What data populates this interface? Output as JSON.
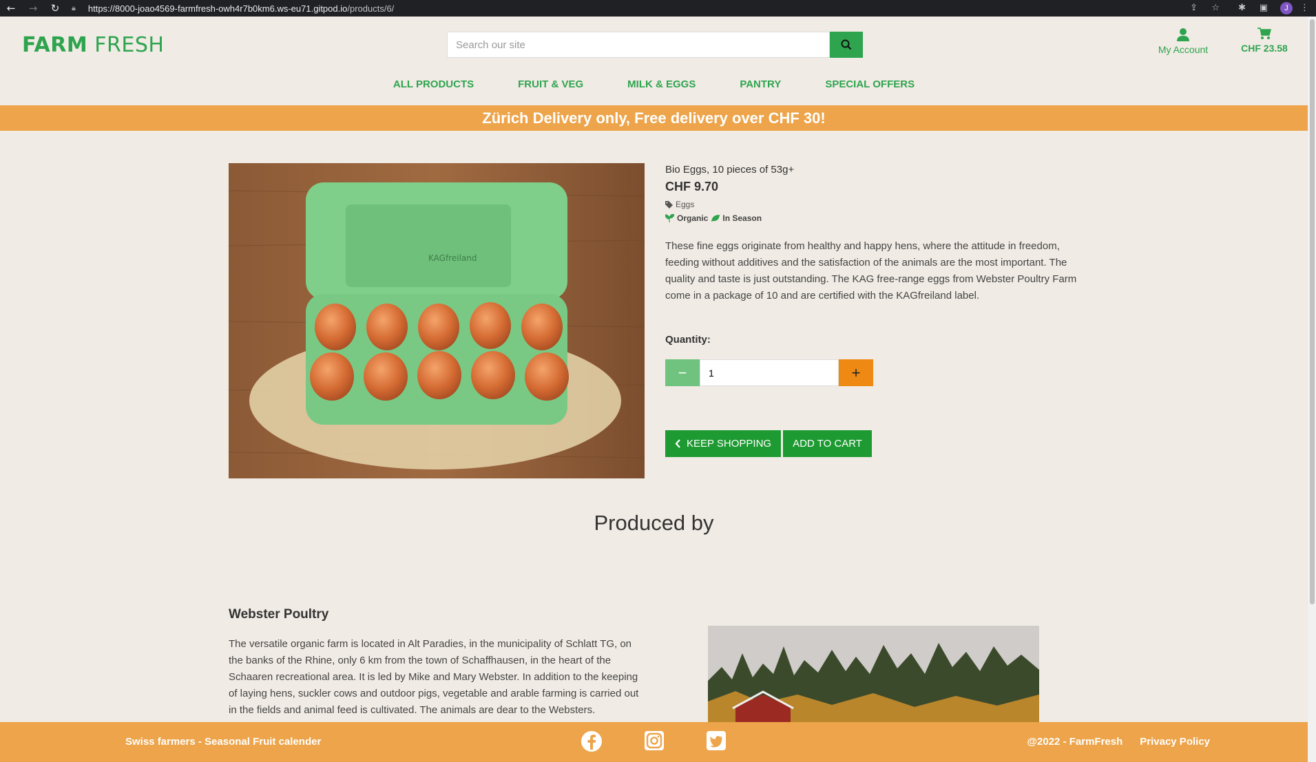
{
  "browser": {
    "url_host": "https://8000-joao4569-farmfresh-owh4r7b0km6.ws-eu71.gitpod.io",
    "url_path": "/products/6/",
    "profile_initial": "J"
  },
  "header": {
    "logo_bold": "FARM",
    "logo_light": " FRESH",
    "search_placeholder": "Search our site",
    "account_label": "My Account",
    "cart_total": "CHF 23.58"
  },
  "nav": {
    "items": [
      "ALL PRODUCTS",
      "FRUIT & VEG",
      "MILK & EGGS",
      "PANTRY",
      "SPECIAL OFFERS"
    ]
  },
  "banner": {
    "text": "Zürich Delivery only, Free delivery over CHF 30!"
  },
  "product": {
    "name": "Bio Eggs, 10 pieces of 53g+",
    "price": "CHF 9.70",
    "category": "Eggs",
    "tag_organic": "Organic",
    "tag_season": "In Season",
    "description": "These fine eggs originate from healthy and happy hens, where the attitude in freedom, feeding without additives and the satisfaction of the animals are the most important. The quality and taste is just outstanding. The KAG free-range eggs from Webster Poultry Farm come in a package of 10 and are certified with the KAGfreiland label.",
    "carton_brand": "KAGfreiland",
    "quantity_label": "Quantity:",
    "quantity_value": "1",
    "keep_shopping": "KEEP SHOPPING",
    "add_to_cart": "ADD TO CART"
  },
  "producer": {
    "heading": "Produced by",
    "name": "Webster Poultry",
    "description": "The versatile organic farm is located in Alt Paradies, in the municipality of Schlatt TG, on the banks of the Rhine, only 6 km from the town of Schaffhausen, in the heart of the Schaaren recreational area. It is led by Mike and Mary Webster. In addition to the keeping of laying hens, suckler cows and outdoor pigs, vegetable and arable farming is carried out in the fields and animal feed is cultivated. The animals are dear to the Websters."
  },
  "footer": {
    "left_link": "Swiss farmers - Seasonal Fruit calender",
    "copyright": "@2022 - FarmFresh",
    "privacy": "Privacy Policy",
    "socials": [
      "facebook-icon",
      "instagram-icon",
      "twitter-icon"
    ]
  },
  "colors": {
    "brand_green": "#2ea44f",
    "button_green": "#1e9a32",
    "banner_orange": "#eda44a",
    "plus_orange": "#ee8a14",
    "background": "#f0ebe4"
  }
}
